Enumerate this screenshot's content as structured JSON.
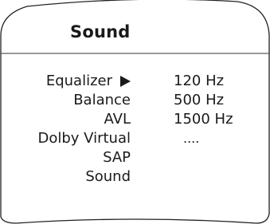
{
  "menu": {
    "title": "Sound",
    "items": [
      {
        "label": "Equalizer",
        "selected": true
      },
      {
        "label": "Balance"
      },
      {
        "label": "AVL"
      },
      {
        "label": "Dolby Virtual"
      },
      {
        "label": "SAP"
      },
      {
        "label": "Sound"
      }
    ]
  },
  "submenu": {
    "values": [
      "120 Hz",
      "500 Hz",
      "1500 Hz",
      "...."
    ]
  },
  "icons": {
    "selection_arrow": "triangle-right-icon"
  }
}
